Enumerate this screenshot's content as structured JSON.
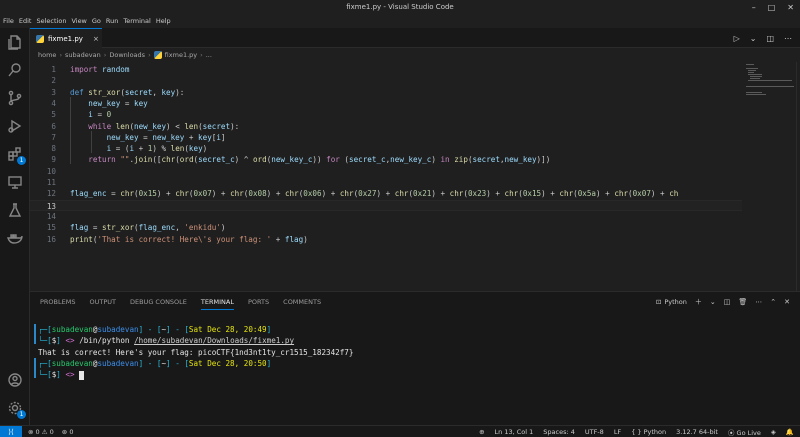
{
  "window": {
    "title": "fixme1.py - Visual Studio Code"
  },
  "menu": [
    "File",
    "Edit",
    "Selection",
    "View",
    "Go",
    "Run",
    "Terminal",
    "Help"
  ],
  "activity": {
    "extensions_badge": "1",
    "accounts_badge": "1"
  },
  "tab": {
    "label": "fixme1.py",
    "close": "×"
  },
  "breadcrumb": [
    "home",
    "subadevan",
    "Downloads",
    "fixme1.py",
    "..."
  ],
  "editor": {
    "current_line": 13,
    "lines": [
      {
        "n": "1",
        "html": "<span class='kw2'>import</span> <span class='var'>random</span>"
      },
      {
        "n": "2",
        "html": ""
      },
      {
        "n": "3",
        "html": "<span class='kw'>def</span> <span class='fn'>str_xor</span>(<span class='var'>secret</span>, <span class='var'>key</span>):"
      },
      {
        "n": "4",
        "html": "    <span class='var'>new_key</span> = <span class='var'>key</span>"
      },
      {
        "n": "5",
        "html": "    <span class='var'>i</span> = <span class='num'>0</span>"
      },
      {
        "n": "6",
        "html": "    <span class='kw2'>while</span> <span class='fn'>len</span>(<span class='var'>new_key</span>) &lt; <span class='fn'>len</span>(<span class='var'>secret</span>):"
      },
      {
        "n": "7",
        "html": "        <span class='var'>new_key</span> = <span class='var'>new_key</span> + <span class='var'>key</span>[<span class='var'>i</span>]"
      },
      {
        "n": "8",
        "html": "        <span class='var'>i</span> = (<span class='var'>i</span> + <span class='num'>1</span>) % <span class='fn'>len</span>(<span class='var'>key</span>)"
      },
      {
        "n": "9",
        "html": "    <span class='kw2'>return</span> <span class='str'>\"\"</span>.<span class='fn'>join</span>([<span class='fn'>chr</span>(<span class='fn'>ord</span>(<span class='var'>secret_c</span>) ^ <span class='fn'>ord</span>(<span class='var'>new_key_c</span>)) <span class='kw2'>for</span> (<span class='var'>secret_c</span>,<span class='var'>new_key_c</span>) <span class='kw2'>in</span> <span class='fn'>zip</span>(<span class='var'>secret</span>,<span class='var'>new_key</span>)])"
      },
      {
        "n": "10",
        "html": ""
      },
      {
        "n": "11",
        "html": ""
      },
      {
        "n": "12",
        "html": "<span class='var'>flag_enc</span> = <span class='fn'>chr</span>(<span class='num'>0x15</span>) + <span class='fn'>chr</span>(<span class='num'>0x07</span>) + <span class='fn'>chr</span>(<span class='num'>0x08</span>) + <span class='fn'>chr</span>(<span class='num'>0x06</span>) + <span class='fn'>chr</span>(<span class='num'>0x27</span>) + <span class='fn'>chr</span>(<span class='num'>0x21</span>) + <span class='fn'>chr</span>(<span class='num'>0x23</span>) + <span class='fn'>chr</span>(<span class='num'>0x15</span>) + <span class='fn'>chr</span>(<span class='num'>0x5a</span>) + <span class='fn'>chr</span>(<span class='num'>0x07</span>) + <span class='fn'>ch</span>"
      },
      {
        "n": "13",
        "html": ""
      },
      {
        "n": "14",
        "html": ""
      },
      {
        "n": "15",
        "html": "<span class='var'>flag</span> = <span class='fn'>str_xor</span>(<span class='var'>flag_enc</span>, <span class='str'>'enkidu'</span>)"
      },
      {
        "n": "16",
        "html": "<span class='fn'>print</span>(<span class='str'>'That is correct! Here\\'s your flag: '</span> + <span class='var'>flag</span>)"
      }
    ]
  },
  "panel": {
    "tabs": [
      "PROBLEMS",
      "OUTPUT",
      "DEBUG CONSOLE",
      "TERMINAL",
      "PORTS",
      "COMMENTS"
    ],
    "active_tab": "TERMINAL",
    "shell": "Python",
    "terminal_lines": [
      "<span class='t-cyan'>┌─[</span><span class='t-green'>subadevan</span><span class='t-white'>@</span><span class='t-blue'>subadevan</span><span class='t-cyan'>] - [</span><span class='t-white'>~</span><span class='t-cyan'>] - [</span><span class='t-yellow'>Sat Dec 28, 20:49</span><span class='t-cyan'>]</span>",
      "<span class='t-cyan'>└─[</span><span class='t-white'>$</span><span class='t-cyan'>]</span> <span class='t-purple'>&lt;&gt;</span> <span class='t-white'>/bin/python</span> <span class='t-under'>/home/subadevan/Downloads/fixme1.py</span>",
      "<span class='t-white'>That is correct! Here's your flag: picoCTF{1nd3nt1ty_cr1515_182342f7}</span>",
      "<span class='t-cyan'>┌─[</span><span class='t-green'>subadevan</span><span class='t-white'>@</span><span class='t-blue'>subadevan</span><span class='t-cyan'>] - [</span><span class='t-white'>~</span><span class='t-cyan'>] - [</span><span class='t-yellow'>Sat Dec 28, 20:50</span><span class='t-cyan'>]</span>",
      "<span class='t-cyan'>└─[</span><span class='t-white'>$</span><span class='t-cyan'>]</span> <span class='t-purple'>&lt;&gt;</span> <span class='cursor'></span>"
    ]
  },
  "status": {
    "errors": "0",
    "warnings": "0",
    "ports": "0",
    "position": "Ln 13, Col 1",
    "spaces": "Spaces: 4",
    "encoding": "UTF-8",
    "eol": "LF",
    "language": "Python",
    "interpreter": "3.12.7 64-bit",
    "golive": "Go Live"
  },
  "colors": {
    "accent": "#0078d4",
    "background": "#1f1f1f"
  }
}
